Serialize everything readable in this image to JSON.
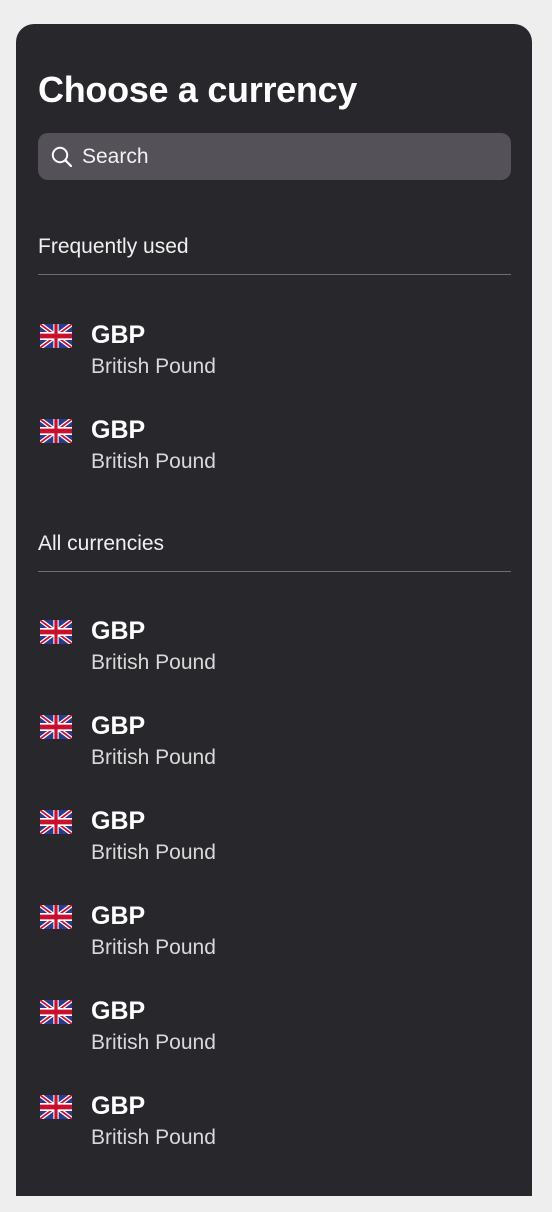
{
  "header": {
    "title": "Choose a currency"
  },
  "search": {
    "placeholder": "Search",
    "value": ""
  },
  "sections": [
    {
      "title": "Frequently used",
      "items": [
        {
          "code": "GBP",
          "name": "British Pound",
          "flag": "uk-flag-icon"
        },
        {
          "code": "GBP",
          "name": "British Pound",
          "flag": "uk-flag-icon"
        }
      ]
    },
    {
      "title": "All currencies",
      "items": [
        {
          "code": "GBP",
          "name": "British Pound",
          "flag": "uk-flag-icon"
        },
        {
          "code": "GBP",
          "name": "British Pound",
          "flag": "uk-flag-icon"
        },
        {
          "code": "GBP",
          "name": "British Pound",
          "flag": "uk-flag-icon"
        },
        {
          "code": "GBP",
          "name": "British Pound",
          "flag": "uk-flag-icon"
        },
        {
          "code": "GBP",
          "name": "British Pound",
          "flag": "uk-flag-icon"
        },
        {
          "code": "GBP",
          "name": "British Pound",
          "flag": "uk-flag-icon"
        }
      ]
    }
  ],
  "colors": {
    "background": "#eeeeee",
    "panel": "#28272c",
    "search_field": "#545159",
    "divider": "#6e6c72",
    "text_primary": "#ffffff",
    "text_secondary": "#d9d9d9"
  }
}
